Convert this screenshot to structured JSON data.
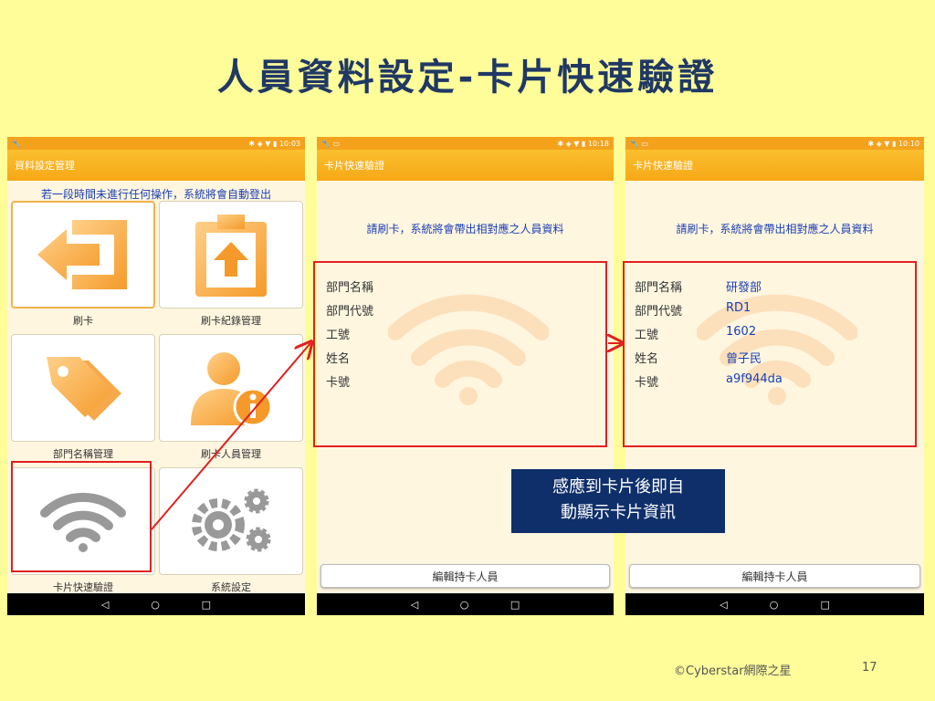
{
  "slide": {
    "title": "人員資料設定-卡片快速驗證",
    "footer": "©Cyberstar網際之星",
    "page_number": "17",
    "callout": [
      "感應到卡片後即自",
      "動顯示卡片資訊"
    ]
  },
  "colors": {
    "slide_bg": "#fffd99",
    "appbar": "#f6a816",
    "highlight": "#e02020",
    "callout_bg": "#0f2f6a",
    "value_text": "#1a3fb4"
  },
  "phone1": {
    "time": "10:03",
    "appbar_title": "資料設定管理",
    "notice": "若一段時間未進行任何操作，系統將會自動登出",
    "tiles": [
      {
        "label": "刷卡",
        "icon": "logout-arrow-icon"
      },
      {
        "label": "刷卡紀錄管理",
        "icon": "clipboard-upload-icon"
      },
      {
        "label": "部門名稱管理",
        "icon": "tags-icon"
      },
      {
        "label": "刷卡人員管理",
        "icon": "user-info-icon"
      },
      {
        "label": "卡片快速驗證",
        "icon": "wifi-icon"
      },
      {
        "label": "系統設定",
        "icon": "gears-icon"
      }
    ]
  },
  "phone2": {
    "time": "10:18",
    "appbar_title": "卡片快速驗證",
    "prompt": "請刷卡，系統將會帶出相對應之人員資料",
    "fields": [
      "部門名稱",
      "部門代號",
      "工號",
      "姓名",
      "卡號"
    ],
    "button": "編輯持卡人員"
  },
  "phone3": {
    "time": "10:10",
    "appbar_title": "卡片快速驗證",
    "prompt": "請刷卡，系統將會帶出相對應之人員資料",
    "fields": [
      "部門名稱",
      "部門代號",
      "工號",
      "姓名",
      "卡號"
    ],
    "values": [
      "研發部",
      "RD1",
      "1602",
      "曾子民",
      "a9f944da"
    ],
    "button": "編輯持卡人員"
  },
  "nav": {
    "back": "◁",
    "home": "○",
    "recent": "□"
  }
}
